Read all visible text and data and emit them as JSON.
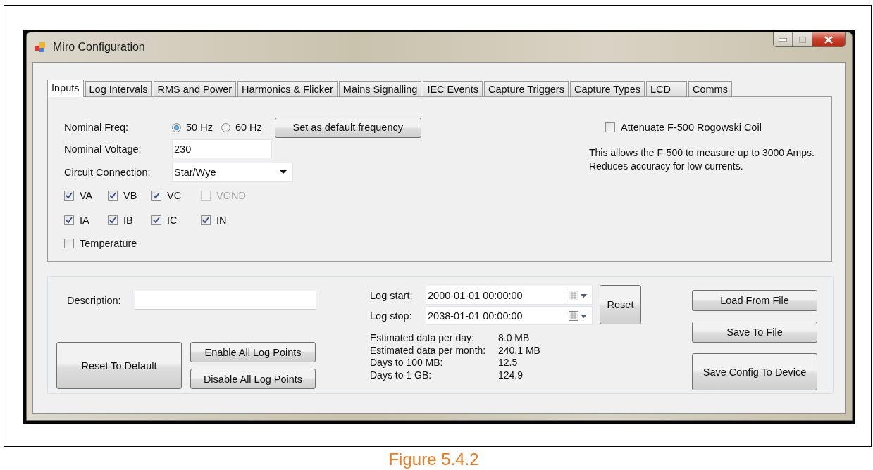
{
  "window": {
    "title": "Miro Configuration"
  },
  "tabs": [
    {
      "label": "Inputs",
      "selected": true
    },
    {
      "label": "Log Intervals",
      "selected": false
    },
    {
      "label": "RMS and Power",
      "selected": false
    },
    {
      "label": "Harmonics & Flicker",
      "selected": false
    },
    {
      "label": "Mains Signalling",
      "selected": false
    },
    {
      "label": "IEC Events",
      "selected": false
    },
    {
      "label": "Capture Triggers",
      "selected": false
    },
    {
      "label": "Capture Types",
      "selected": false
    },
    {
      "label": "LCD",
      "selected": false
    },
    {
      "label": "Comms",
      "selected": false
    }
  ],
  "inputs": {
    "nominal_freq": {
      "label": "Nominal Freq:",
      "options": [
        {
          "label": "50 Hz",
          "selected": true
        },
        {
          "label": "60 Hz",
          "selected": false
        }
      ],
      "button": "Set as default frequency"
    },
    "nominal_voltage": {
      "label": "Nominal Voltage:",
      "value": "230"
    },
    "circuit_connection": {
      "label": "Circuit Connection:",
      "value": "Star/Wye"
    },
    "checkbox_rows": [
      {
        "items": [
          {
            "label": "VA",
            "checked": true,
            "disabled": false
          },
          {
            "label": "VB",
            "checked": true,
            "disabled": false
          },
          {
            "label": "VC",
            "checked": true,
            "disabled": false
          },
          {
            "label": "VGND",
            "checked": false,
            "disabled": true
          }
        ]
      },
      {
        "items": [
          {
            "label": "IA",
            "checked": true,
            "disabled": false
          },
          {
            "label": "IB",
            "checked": true,
            "disabled": false
          },
          {
            "label": "IC",
            "checked": true,
            "disabled": false
          },
          {
            "label": "IN",
            "checked": true,
            "disabled": false
          }
        ]
      },
      {
        "items": [
          {
            "label": "Temperature",
            "checked": false,
            "disabled": false
          }
        ]
      }
    ],
    "attenuate": {
      "label": "Attenuate F-500 Rogowski Coil",
      "checked": false
    },
    "note": "This allows the F-500 to measure up to 3000 Amps.\nReduces accuracy for low currents."
  },
  "log": {
    "description": {
      "label": "Description:"
    },
    "reset_to_default": "Reset To Default",
    "enable_all": "Enable All Log Points",
    "disable_all": "Disable All Log Points",
    "log_start": {
      "label": "Log start:",
      "value": "2000-01-01 00:00:00"
    },
    "log_stop": {
      "label": "Log stop:",
      "value": "2038-01-01 00:00:00"
    },
    "reset": "Reset",
    "stats": [
      {
        "label": "Estimated data per day:",
        "value": "8.0 MB"
      },
      {
        "label": "Estimated data per month:",
        "value": "240.1 MB"
      },
      {
        "label": "Days to 100 MB:",
        "value": "12.5"
      },
      {
        "label": "Days to 1 GB:",
        "value": "124.9"
      }
    ],
    "file_buttons": [
      "Load From File",
      "Save To File",
      "Save Config To Device"
    ]
  },
  "caption": "Figure 5.4.2"
}
